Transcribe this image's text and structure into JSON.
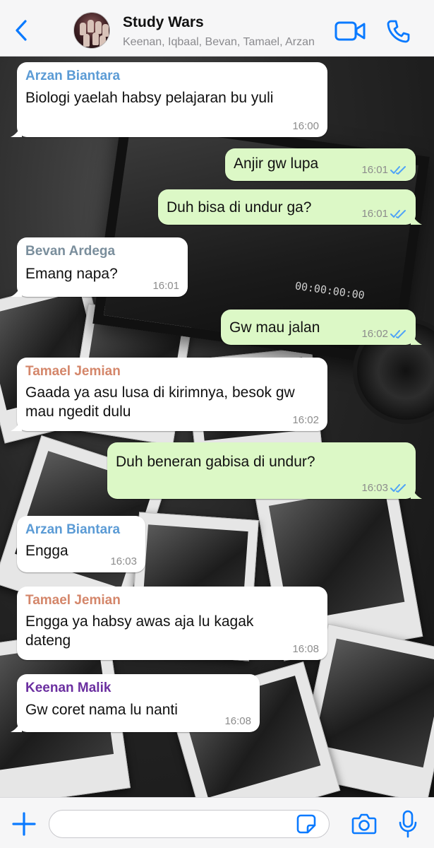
{
  "header": {
    "title": "Study Wars",
    "subtitle": "Keenan, Iqbaal, Bevan, Tamael, Arzan",
    "accent": "#0a7aff"
  },
  "wallpaper": {
    "monitor_readout": "00:00:00:00"
  },
  "messages": [
    {
      "dir": "in",
      "sender": "Arzan Biantara",
      "sender_color": "#5b9bd5",
      "text": "Biologi yaelah habsy pelajaran bu yuli",
      "time": "16:00"
    },
    {
      "dir": "out",
      "text": "Anjir gw lupa",
      "time": "16:01",
      "status": "read"
    },
    {
      "dir": "out",
      "text": "Duh bisa di undur ga?",
      "time": "16:01",
      "status": "read"
    },
    {
      "dir": "in",
      "sender": "Bevan Ardega",
      "sender_color": "#7a8e9c",
      "text": "Emang napa?",
      "time": "16:01"
    },
    {
      "dir": "out",
      "text": "Gw mau jalan",
      "time": "16:02",
      "status": "read"
    },
    {
      "dir": "in",
      "sender": "Tamael Jemian",
      "sender_color": "#d4866a",
      "text": "Gaada ya asu lusa di kirimnya, besok gw mau ngedit dulu",
      "time": "16:02"
    },
    {
      "dir": "out",
      "text": "Duh beneran gabisa di undur?",
      "time": "16:03",
      "status": "read"
    },
    {
      "dir": "in",
      "sender": "Arzan Biantara",
      "sender_color": "#5b9bd5",
      "text": "Engga",
      "time": "16:03"
    },
    {
      "dir": "in",
      "sender": "Tamael Jemian",
      "sender_color": "#d4866a",
      "text": "Engga ya habsy awas aja lu kagak dateng",
      "time": "16:08"
    },
    {
      "dir": "in",
      "sender": "Keenan Malik",
      "sender_color": "#6b2fa0",
      "text": "Gw coret nama lu nanti",
      "time": "16:08"
    }
  ],
  "input": {
    "value": "",
    "placeholder": ""
  },
  "icons": {
    "back": "chevron-left-icon",
    "video": "video-camera-icon",
    "call": "phone-icon",
    "plus": "plus-icon",
    "sticker": "sticker-icon",
    "camera": "camera-icon",
    "mic": "microphone-icon"
  }
}
